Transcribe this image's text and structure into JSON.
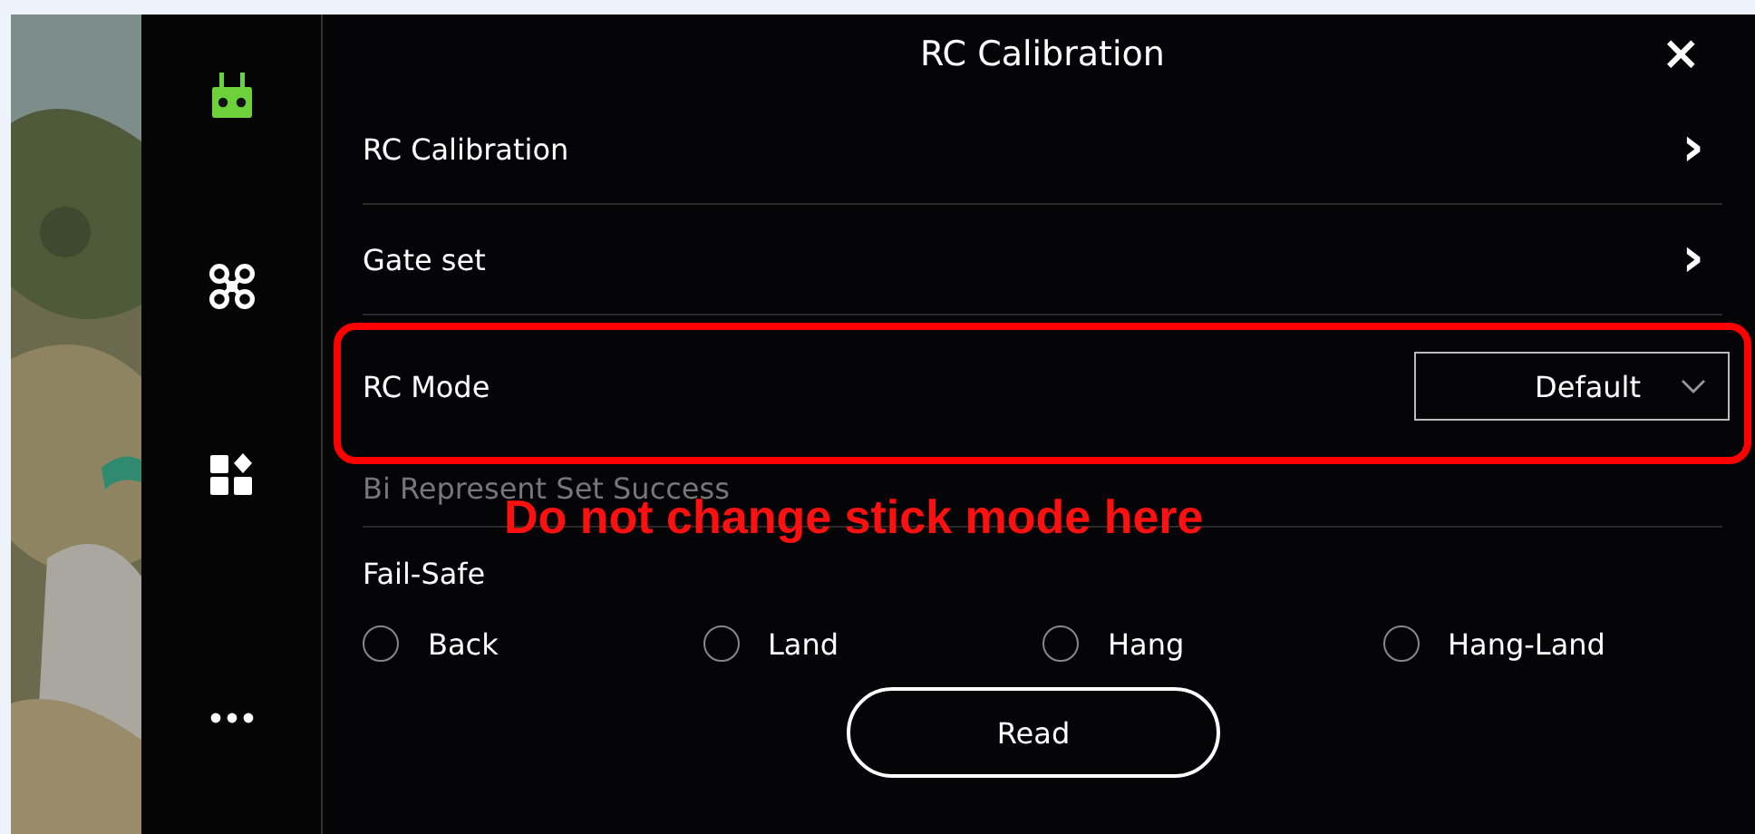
{
  "sidebar": {
    "items": [
      {
        "kind": "remote",
        "selected": true
      },
      {
        "kind": "drone",
        "selected": false
      },
      {
        "kind": "apps",
        "selected": false
      },
      {
        "kind": "more",
        "selected": false
      }
    ]
  },
  "panel": {
    "title": "RC Calibration",
    "close": "×",
    "rows": [
      {
        "kind": "link",
        "label": "RC Calibration",
        "chevron": "›"
      },
      {
        "kind": "link",
        "label": "Gate set",
        "chevron": "›"
      },
      {
        "kind": "select",
        "label": "RC Mode",
        "value": "Default"
      },
      {
        "kind": "note",
        "label": "Bi Represent Set Success"
      },
      {
        "kind": "heading",
        "label": "Fail-Safe"
      }
    ],
    "fail_safe": [
      {
        "label": "Back",
        "selected": false
      },
      {
        "label": "Land",
        "selected": false
      },
      {
        "label": "Hang",
        "selected": false
      },
      {
        "label": "Hang-Land",
        "selected": false
      }
    ],
    "read_button": "Read"
  },
  "annotation": {
    "text": "Do not change stick mode here"
  }
}
